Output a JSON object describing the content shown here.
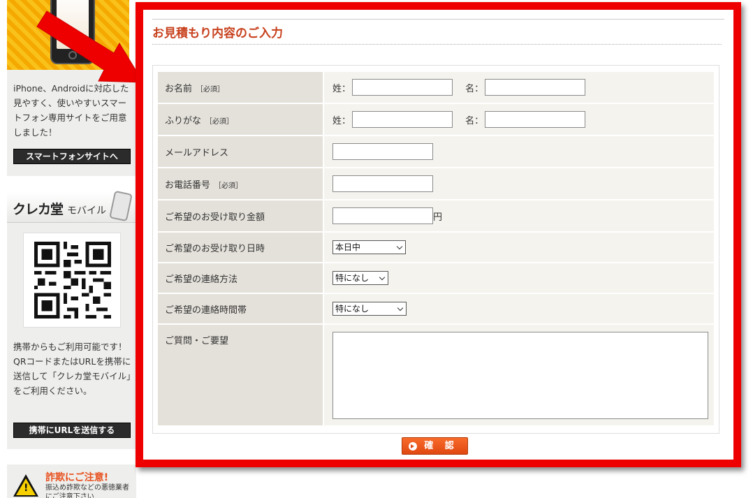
{
  "sidebar": {
    "smartphone": {
      "text": "iPhone、Androidに対応した見やすく、使いやすいスマートフォン専用サイトをご用意しました！",
      "button": "スマートフォンサイトへ"
    },
    "mobile": {
      "logo": "クレカ堂",
      "subtitle": "モバイル",
      "text": "携帯からもご利用可能です！QRコードまたはURLを携帯に送信して「クレカ堂モバイル」をご利用ください。",
      "button": "携帯にURLを送信する"
    },
    "warning": {
      "title": "詐欺にご注意!",
      "subtitle": "振込め詐欺などの悪徳業者にご注意下さい"
    }
  },
  "form": {
    "title": "お見積もり内容のご入力",
    "required_tag": "［必須］",
    "last_name_cap": "姓：",
    "first_name_cap": "名：",
    "yen": "円",
    "rows": {
      "name": "お名前",
      "furigana": "ふりがな",
      "email": "メールアドレス",
      "phone": "お電話番号",
      "amount": "ご希望のお受け取り金額",
      "date": "ご希望のお受け取り日時",
      "contact_method": "ご希望の連絡方法",
      "contact_time": "ご希望の連絡時間帯",
      "question": "ご質問・ご要望"
    },
    "selects": {
      "date": "本日中",
      "contact_method": "特になし",
      "contact_time": "特になし"
    },
    "submit": "確 認"
  },
  "colors": {
    "highlight_border": "#ee0000",
    "title": "#c7401c",
    "submit": "#e8501e"
  }
}
